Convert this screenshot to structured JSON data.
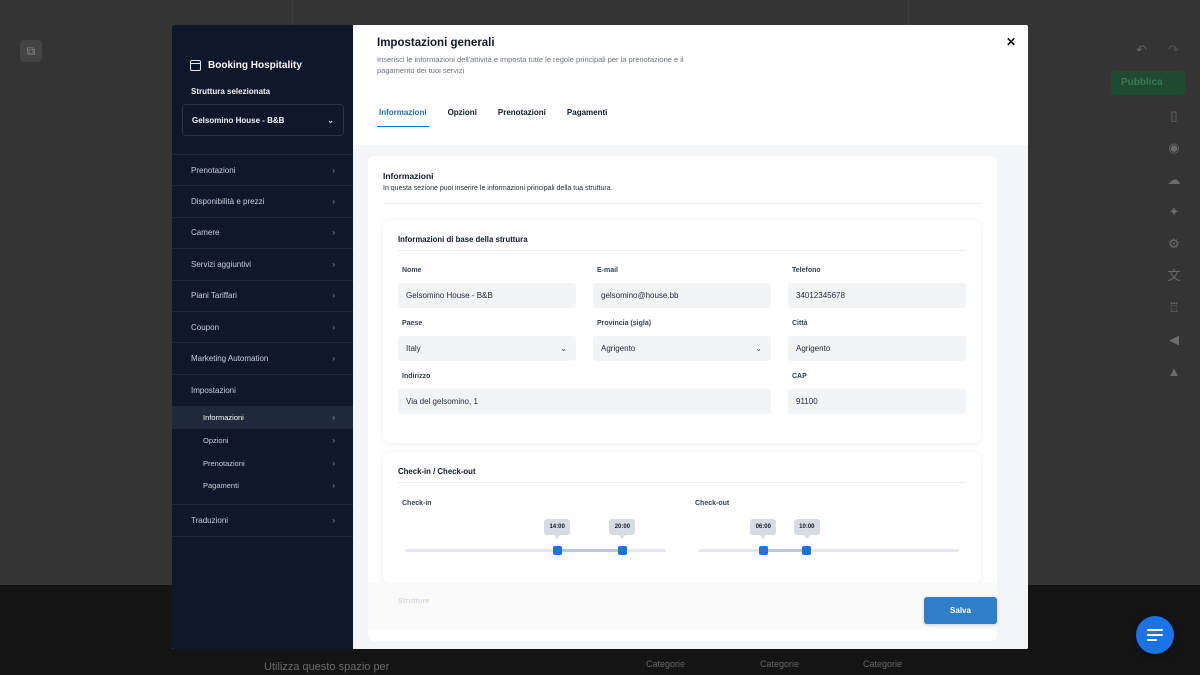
{
  "background": {
    "publish_label": "Pubblica",
    "footer_text": "Utilizza questo spazio per",
    "categories": [
      "Categorie",
      "Categorie",
      "Categorie"
    ]
  },
  "sidebar": {
    "brand": "Booking Hospitality",
    "structure_label": "Struttura selezionata",
    "structure_value": "Gelsomino House - B&B",
    "items": [
      {
        "label": "Prenotazioni"
      },
      {
        "label": "Disponibilità e prezzi"
      },
      {
        "label": "Camere"
      },
      {
        "label": "Servizi aggiuntivi"
      },
      {
        "label": "Piani Tariffari"
      },
      {
        "label": "Coupon"
      },
      {
        "label": "Marketing Automation"
      },
      {
        "label": "Impostazioni"
      }
    ],
    "subitems": [
      {
        "label": "Informazioni"
      },
      {
        "label": "Opzioni"
      },
      {
        "label": "Prenotazioni"
      },
      {
        "label": "Pagamenti"
      }
    ],
    "last_item": "Traduzioni"
  },
  "header": {
    "title": "Impostazioni generali",
    "subtitle": "Inserisci le informazioni dell'attività e imposta tutte le regole principali per la prenotazione e il pagamento dei tuoi servizi"
  },
  "tabs": [
    {
      "label": "Informazioni"
    },
    {
      "label": "Opzioni"
    },
    {
      "label": "Prenotazioni"
    },
    {
      "label": "Pagamenti"
    }
  ],
  "info": {
    "title": "Informazioni",
    "subtitle": "In questa sezione puoi inserire le informazioni principali della tua struttura."
  },
  "basic": {
    "title": "Informazioni di base della struttura",
    "nome_label": "Nome",
    "nome_value": "Gelsomino House - B&B",
    "email_label": "E-mail",
    "email_value": "gelsomino@house.bb",
    "telefono_label": "Telefono",
    "telefono_value": "34012345678",
    "paese_label": "Paese",
    "paese_value": "Italy",
    "provincia_label": "Provincia (sigla)",
    "provincia_value": "Agrigento",
    "citta_label": "Città",
    "citta_value": "Agrigento",
    "indirizzo_label": "Indirizzo",
    "indirizzo_value": "Via del gelsomino, 1",
    "cap_label": "CAP",
    "cap_value": "91100"
  },
  "checkinout": {
    "title": "Check-in / Check-out",
    "checkin_label": "Check-in",
    "checkin_from": "14:00",
    "checkin_to": "20:00",
    "checkin_from_fraction": 0.583,
    "checkin_to_fraction": 0.833,
    "checkout_label": "Check-out",
    "checkout_from": "06:00",
    "checkout_to": "10:00",
    "checkout_from_fraction": 0.25,
    "checkout_to_fraction": 0.417
  },
  "footer": {
    "strutture_label": "Strutture",
    "save_label": "Salva"
  },
  "colors": {
    "sidebar_bg": "#0f172a",
    "accent": "#1d6fb8",
    "save_button": "#2f7fc6",
    "slider_handle": "#1a73e8"
  }
}
